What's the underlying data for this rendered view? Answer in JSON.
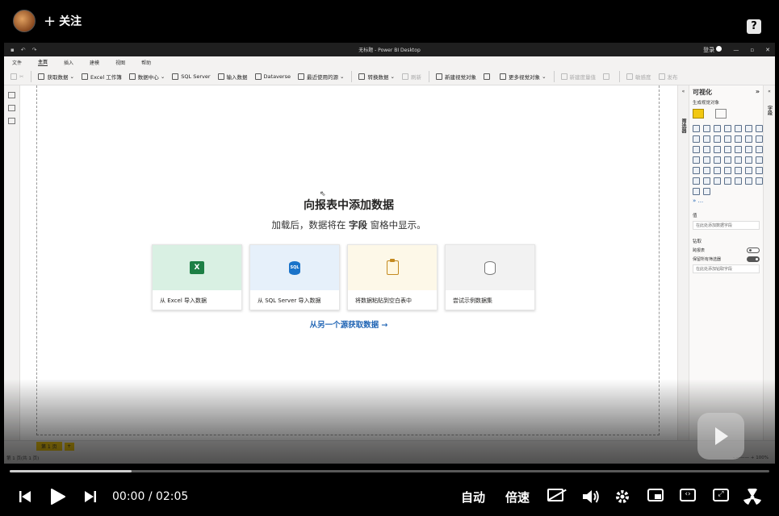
{
  "overlay": {
    "follow_label": "关注",
    "help_icon": "?"
  },
  "app": {
    "window_title": "无标题 - Power BI Desktop",
    "signin_label": "登录",
    "menu": [
      "文件",
      "主页",
      "插入",
      "建模",
      "视图",
      "帮助"
    ],
    "menu_active": "主页",
    "ribbon": {
      "get_data": "获取数据",
      "excel_workbook": "Excel 工作簿",
      "data_hub": "数据中心",
      "sql_server": "SQL Server",
      "enter_data": "输入数据",
      "dataverse": "Dataverse",
      "recent_sources": "最近使用的源",
      "transform_data": "转换数据",
      "refresh": "刷新",
      "new_visual": "新建视觉对象",
      "more_visuals": "更多视觉对象",
      "new_measure": "新建度量值",
      "sensitivity": "敏感度",
      "publish": "发布"
    },
    "canvas": {
      "title": "向报表中添加数据",
      "subtitle_before": "加载后，数据将在",
      "subtitle_bold": "字段",
      "subtitle_after": "窗格中显示。",
      "cards": [
        {
          "label": "从 Excel 导入数据",
          "icon": "excel-icon"
        },
        {
          "label": "从 SQL Server 导入数据",
          "icon": "sql-server-icon"
        },
        {
          "label": "将数据粘贴到空白表中",
          "icon": "paste-icon"
        },
        {
          "label": "尝试示例数据集",
          "icon": "sample-data-icon"
        }
      ],
      "more_link": "从另一个源获取数据 →",
      "card_colors": [
        "#d9f0e3",
        "#e6f0fa",
        "#fdf8e8",
        "#f2f2f2"
      ]
    },
    "filters_label": "筛选器",
    "fields_label": "字段",
    "viz": {
      "title": "可视化",
      "build_label": "生成视觉对象",
      "values_label": "值",
      "values_placeholder": "在此处添加数据字段",
      "drill_label": "钻取",
      "cross_report": "跨报表",
      "keep_filters": "保留所有筛选器",
      "drill_placeholder": "在此处添加钻取字段",
      "more": "..."
    },
    "page_tab": "第 1 页",
    "status_left": "第 1 页(共 1 页)",
    "zoom": "- ——— + 100%"
  },
  "player": {
    "current_time": "00:00",
    "separator": "/",
    "duration": "02:05",
    "auto_label": "自动",
    "speed_label": "倍速",
    "progress": 0.16
  }
}
